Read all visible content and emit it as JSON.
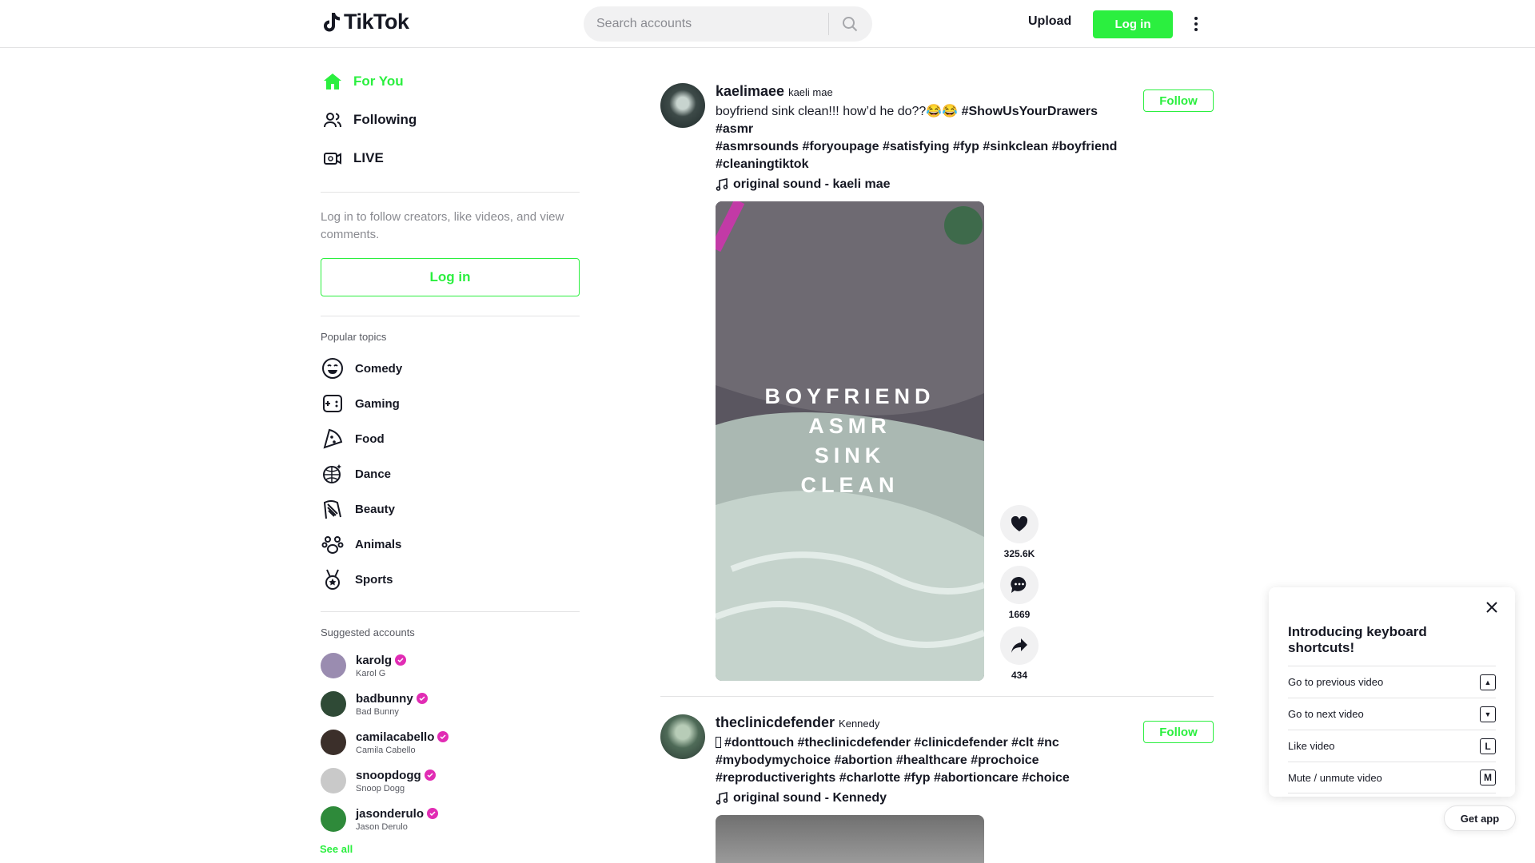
{
  "header": {
    "logo_text": "TikTok",
    "search_placeholder": "Search accounts",
    "upload_label": "Upload",
    "login_label": "Log in"
  },
  "sidebar": {
    "nav": [
      {
        "label": "For You",
        "icon": "home-icon",
        "active": true
      },
      {
        "label": "Following",
        "icon": "users-icon",
        "active": false
      },
      {
        "label": "LIVE",
        "icon": "live-icon",
        "active": false
      }
    ],
    "login_prompt": "Log in to follow creators, like videos, and view comments.",
    "login_label": "Log in",
    "topics_title": "Popular topics",
    "topics": [
      {
        "label": "Comedy",
        "icon": "comedy-icon"
      },
      {
        "label": "Gaming",
        "icon": "gaming-icon"
      },
      {
        "label": "Food",
        "icon": "food-icon"
      },
      {
        "label": "Dance",
        "icon": "dance-icon"
      },
      {
        "label": "Beauty",
        "icon": "beauty-icon"
      },
      {
        "label": "Animals",
        "icon": "animals-icon"
      },
      {
        "label": "Sports",
        "icon": "sports-icon"
      }
    ],
    "suggested_title": "Suggested accounts",
    "accounts": [
      {
        "username": "karolg",
        "name": "Karol G"
      },
      {
        "username": "badbunny",
        "name": "Bad Bunny"
      },
      {
        "username": "camilacabello",
        "name": "Camila Cabello"
      },
      {
        "username": "snoopdogg",
        "name": "Snoop Dogg"
      },
      {
        "username": "jasonderulo",
        "name": "Jason Derulo"
      }
    ],
    "see_all": "See all"
  },
  "feed": {
    "posts": [
      {
        "username": "kaelimaee",
        "nickname": "kaeli mae",
        "caption": "boyfriend sink clean!!! how’d he do??😂😂",
        "tags_line1": "#ShowUsYourDrawers #asmr",
        "tags_line2": "#asmrsounds #foryoupage #satisfying #fyp #sinkclean #boyfriend",
        "tags_line3": "#cleaningtiktok",
        "music": "original sound - kaeli mae",
        "follow_label": "Follow",
        "overlay": [
          "BOYFRIEND",
          "ASMR",
          "SINK",
          "CLEAN"
        ],
        "likes": "325.6K",
        "comments": "1669",
        "shares": "434"
      },
      {
        "username": "theclinicdefender",
        "nickname": "Kennedy",
        "caption": "",
        "tags_line1": "#donttouch #theclinicdefender #clinicdefender #clt #nc",
        "tags_line2": "#mybodymychoice #abortion #healthcare #prochoice",
        "tags_line3": "#reproductiverights #charlotte #fyp #abortioncare #choice",
        "music": "original sound - Kennedy",
        "follow_label": "Follow"
      }
    ]
  },
  "keyboard_panel": {
    "title": "Introducing keyboard shortcuts!",
    "rows": [
      {
        "label": "Go to previous video",
        "key": "▲"
      },
      {
        "label": "Go to next video",
        "key": "▼"
      },
      {
        "label": "Like video",
        "key": "L"
      },
      {
        "label": "Mute / unmute video",
        "key": "M"
      }
    ]
  },
  "get_app_label": "Get app",
  "colors": {
    "accent": "#2bef3f",
    "verified": "#e12cb4",
    "text": "#161823"
  }
}
